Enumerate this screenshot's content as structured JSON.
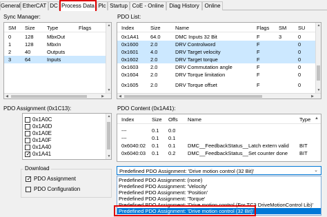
{
  "tabs": [
    "General",
    "EtherCAT",
    "DC",
    "Process Data",
    "Plc",
    "Startup",
    "CoE - Online",
    "Diag History",
    "Online"
  ],
  "sync_manager": {
    "title": "Sync Manager:",
    "columns": [
      "SM",
      "Size",
      "Type",
      "Flags"
    ],
    "rows": [
      [
        "0",
        "128",
        "MbxOut",
        ""
      ],
      [
        "1",
        "128",
        "MbxIn",
        ""
      ],
      [
        "2",
        "40",
        "Outputs",
        ""
      ],
      [
        "3",
        "64",
        "Inputs",
        ""
      ]
    ],
    "selected_row": 3
  },
  "pdo_list": {
    "title": "PDO List:",
    "columns": [
      "Index",
      "Size",
      "Name",
      "Flags",
      "SM",
      "SU"
    ],
    "rows": [
      [
        "0x1A41",
        "64.0",
        "DMC Inputs 32 Bit",
        "F",
        "3",
        "0"
      ],
      [
        "0x1600",
        "2.0",
        "DRV Controlword",
        "F",
        "",
        "0"
      ],
      [
        "0x1601",
        "4.0",
        "DRV Target velocity",
        "F",
        "",
        "0"
      ],
      [
        "0x1602",
        "2.0",
        "DRV Target torque",
        "F",
        "",
        "0"
      ],
      [
        "0x1603",
        "2.0",
        "DRV Commutation angle",
        "F",
        "",
        "0"
      ],
      [
        "0x1604",
        "2.0",
        "DRV Torque limitation",
        "F",
        "",
        "0"
      ],
      [
        "0x1605",
        "2.0",
        "DRV Torque offset",
        "F",
        "",
        "0"
      ]
    ],
    "selected_rows": [
      1,
      2,
      3
    ]
  },
  "pdo_assignment": {
    "title": "PDO Assignment (0x1C13):",
    "items": [
      {
        "label": "0x1A0C",
        "checked": false
      },
      {
        "label": "0x1A0D",
        "checked": false
      },
      {
        "label": "0x1A0E",
        "checked": false
      },
      {
        "label": "0x1A0F",
        "checked": false
      },
      {
        "label": "0x1A40",
        "checked": false
      },
      {
        "label": "0x1A41",
        "checked": true
      }
    ]
  },
  "pdo_content": {
    "title": "PDO Content (0x1A41):",
    "columns": [
      "Index",
      "Size",
      "Offs",
      "Name",
      "Type"
    ],
    "rows": [
      [
        "---",
        "0.1",
        "0.0",
        "",
        ""
      ],
      [
        "---",
        "0.1",
        "0.1",
        "",
        ""
      ],
      [
        "0x6040:02",
        "0.1",
        "0.1",
        "DMC__FeedbackStatus__Latch extern valid",
        "BIT"
      ],
      [
        "0x6040:03",
        "0.1",
        "0.2",
        "DMC__FeedbackStatus__Set counter done",
        "BIT"
      ],
      [
        "",
        "",
        "",
        "",
        ""
      ]
    ]
  },
  "download": {
    "title": "Download",
    "pdo_assignment_label": "PDO Assignment",
    "pdo_assignment_checked": true,
    "pdo_configuration_label": "PDO Configuration",
    "pdo_configuration_checked": false
  },
  "predefined": {
    "selected": "Predefined PDO Assignment: 'Drive motion control (32 Bit)'",
    "options": [
      "Predefined PDO Assignment: (none)",
      "Predefined PDO Assignment: 'Velocity'",
      "Predefined PDO Assignment: 'Position'",
      "Predefined PDO Assignment: 'Torque'",
      "Predefined PDO Assignment: 'Drive motion control (For TC3 DriveMotionControl Lib)'",
      "Predefined PDO Assignment: 'Drive motion control (32 Bit)'"
    ],
    "highlighted_index": 5
  },
  "colors": {
    "highlight": "#e00000",
    "selection": "#0078d7",
    "row_select": "#cce8ff"
  }
}
